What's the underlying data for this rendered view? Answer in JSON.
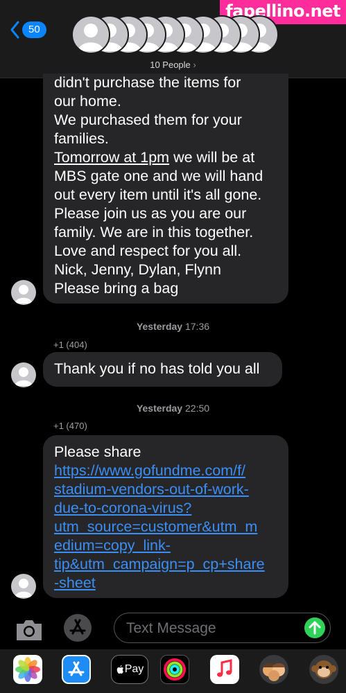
{
  "header": {
    "back_count": "50",
    "people_label": "10 People",
    "watermark": "fapellino.net"
  },
  "messages": [
    {
      "lines": [
        "didn't purchase the items for",
        "our home.",
        "We purchased them for your",
        "families.",
        "Tomorrow at 1pm",
        " we will be at",
        "MBS gate one and we will hand",
        "out every item until it's all gone.",
        "Please join us as you are our",
        "family. We are in this together.",
        "Love and respect for you all.",
        "Nick, Jenny, Dylan, Flynn",
        "Please bring a bag"
      ]
    },
    {
      "timestamp_day": "Yesterday",
      "timestamp_time": "17:36",
      "sender": "+1 (404)",
      "text": "Thank you if no has told you all"
    },
    {
      "timestamp_day": "Yesterday",
      "timestamp_time": "22:50",
      "sender": "+1 (470)",
      "intro": "Please share",
      "link_lines": [
        "https://www.gofundme.com/f/",
        "stadium-vendors-out-of-work-",
        "due-to-corona-virus?",
        "utm_source=customer&utm_m",
        "edium=copy_link-",
        "tip&utm_campaign=p_cp+share",
        "-sheet"
      ]
    }
  ],
  "composer": {
    "placeholder": "Text Message"
  },
  "app_drawer": {
    "apps": [
      "photos-app",
      "app-store-app",
      "apple-pay-app",
      "activity-app",
      "music-app",
      "memoji-app",
      "animoji-app"
    ],
    "apple_pay_label": "Pay"
  },
  "colors": {
    "bubble": "#262628",
    "link": "#3b8ef5",
    "accent_blue": "#0a84ff",
    "send_green": "#30d158",
    "watermark_pink": "#ff2d9c"
  }
}
